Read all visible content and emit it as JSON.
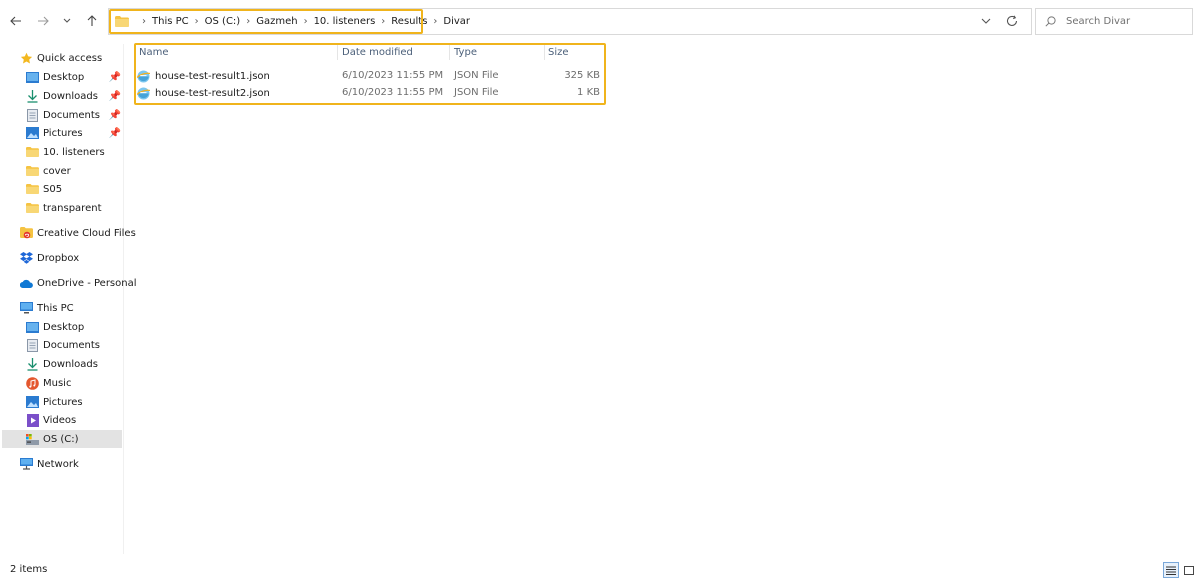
{
  "address": {
    "crumbs": [
      "This PC",
      "OS (C:)",
      "Gazmeh",
      "10. listeners",
      "Results",
      "Divar"
    ]
  },
  "search": {
    "placeholder": "Search Divar"
  },
  "nav": {
    "quick_access": "Quick access",
    "qa_items": [
      "Desktop",
      "Downloads",
      "Documents",
      "Pictures",
      "10. listeners",
      "cover",
      "S05",
      "transparent"
    ],
    "creative_cloud": "Creative Cloud Files",
    "dropbox": "Dropbox",
    "onedrive": "OneDrive - Personal",
    "this_pc": "This PC",
    "pc_items": [
      "Desktop",
      "Documents",
      "Downloads",
      "Music",
      "Pictures",
      "Videos",
      "OS (C:)"
    ],
    "network": "Network"
  },
  "columns": {
    "name": "Name",
    "date": "Date modified",
    "type": "Type",
    "size": "Size"
  },
  "files": [
    {
      "name": "house-test-result1.json",
      "date": "6/10/2023 11:55 PM",
      "type": "JSON File",
      "size": "325 KB"
    },
    {
      "name": "house-test-result2.json",
      "date": "6/10/2023 11:55 PM",
      "type": "JSON File",
      "size": "1 KB"
    }
  ],
  "status": {
    "count": "2 items"
  },
  "colors": {
    "highlight": "#f0b41c",
    "folder": "#f5c342",
    "selected": "#e3e3e3"
  }
}
